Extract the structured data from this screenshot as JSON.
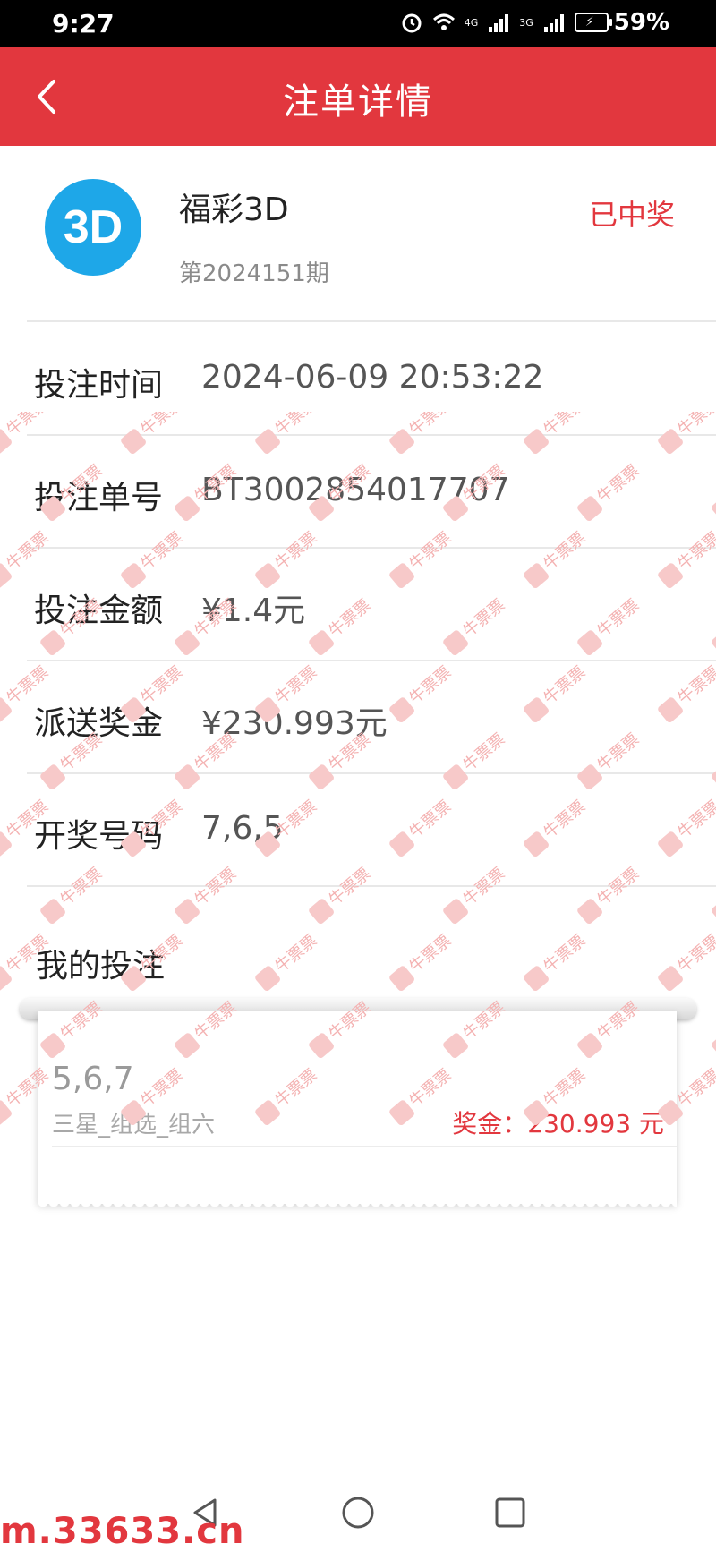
{
  "status_bar": {
    "time": "9:27",
    "network_1": "4G",
    "network_2": "3G",
    "battery_percent": "59%"
  },
  "header": {
    "title": "注单详情",
    "background_color": "#e2373e"
  },
  "lottery": {
    "logo_text": "3D",
    "name": "福彩3D",
    "period": "第2024151期",
    "status": "已中奖"
  },
  "details": {
    "bet_time_label": "投注时间",
    "bet_time_value": "2024-06-09 20:53:22",
    "order_no_label": "投注单号",
    "order_no_value": "BT3002854017707",
    "amount_label": "投注金额",
    "amount_value": "¥1.4元",
    "prize_label": "派送奖金",
    "prize_value": "¥230.993元",
    "draw_label": "开奖号码",
    "draw_value": "7,6,5"
  },
  "my_bets": {
    "title": "我的投注",
    "items": [
      {
        "numbers": "5,6,7",
        "play_type": "三星_组选_组六",
        "prize": "奖金：230.993 元"
      }
    ]
  },
  "watermark": {
    "text": "牛票票"
  },
  "footer": {
    "site_url": "m.33633.cn"
  }
}
